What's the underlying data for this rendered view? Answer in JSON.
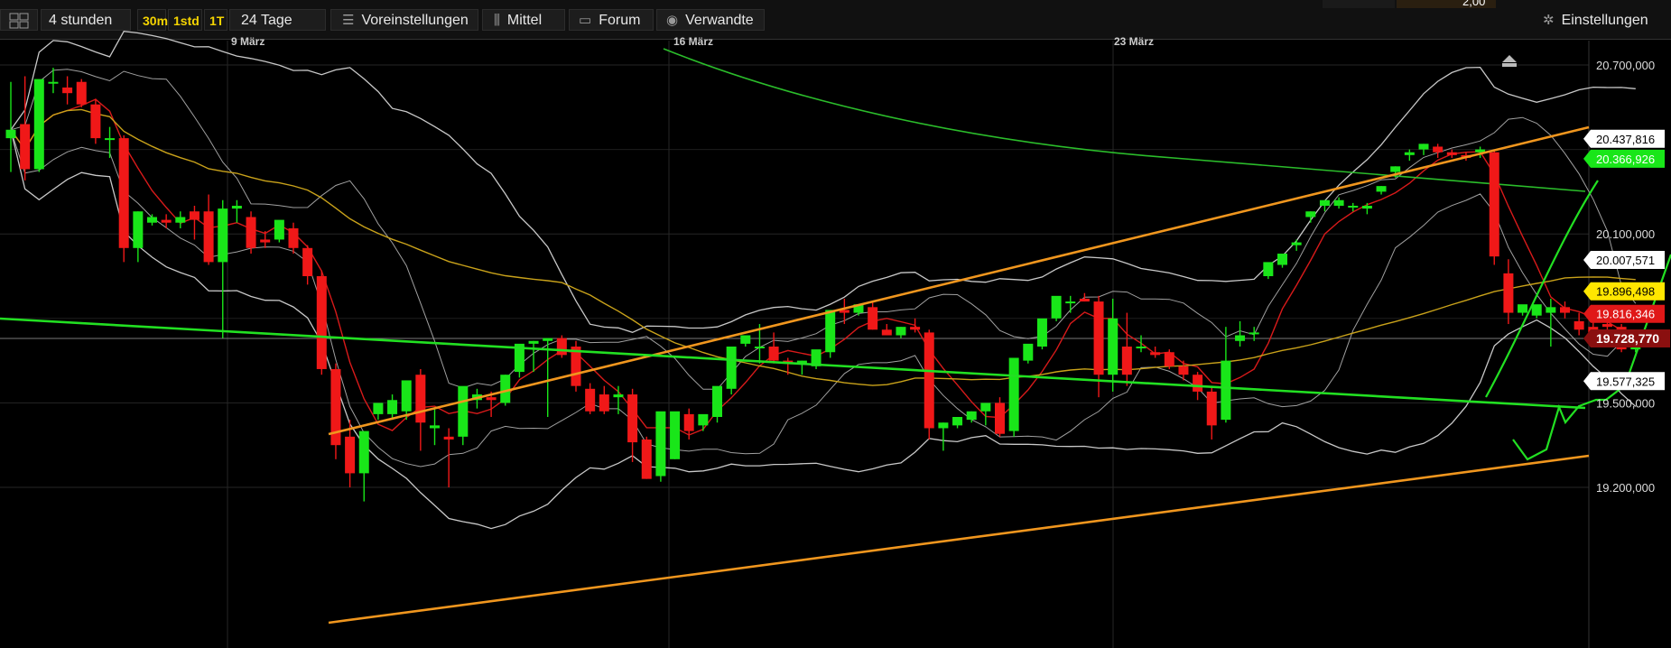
{
  "toolbar": {
    "period": "4 stunden",
    "quick_ranges": [
      "30m",
      "1std",
      "1T"
    ],
    "range": "24 Tage",
    "presets": "Voreinstellungen",
    "average": "Mittel",
    "forum": "Forum",
    "related": "Verwandte",
    "settings": "Einstellungen",
    "top_value": "2,00"
  },
  "chart_data": {
    "type": "candlestick",
    "x_tick_labels": [
      "9 März",
      "16 März",
      "23 März"
    ],
    "y_tick_labels": [
      "20.700,000",
      "20.100,000",
      "19.500,000",
      "19.200,000"
    ],
    "y_ticks": [
      20700,
      20100,
      19500,
      19200
    ],
    "ylim": [
      19050,
      20850
    ],
    "price_labels": [
      {
        "value": 20437.816,
        "text": "20.437,816",
        "style": "white"
      },
      {
        "value": 20366.926,
        "text": "20.366,926",
        "style": "green"
      },
      {
        "value": 20007.571,
        "text": "20.007,571",
        "style": "white"
      },
      {
        "value": 19896.498,
        "text": "19.896,498",
        "style": "yellow"
      },
      {
        "value": 19816.346,
        "text": "19.816,346",
        "style": "red"
      },
      {
        "value": 19728.77,
        "text": "19.728,770",
        "style": "current"
      },
      {
        "value": 19577.325,
        "text": "19.577,325",
        "style": "white"
      }
    ],
    "candles": [
      [
        20440,
        20640,
        20470,
        20320
      ],
      [
        20490,
        20660,
        20330,
        20290
      ],
      [
        20330,
        20640,
        20650,
        20320
      ],
      [
        20640,
        20690,
        20640,
        20600
      ],
      [
        20620,
        20660,
        20600,
        20560
      ],
      [
        20640,
        20650,
        20560,
        20550
      ],
      [
        20560,
        20580,
        20440,
        20420
      ],
      [
        20440,
        20480,
        20440,
        20370
      ],
      [
        20440,
        20450,
        20050,
        20000
      ],
      [
        20050,
        20180,
        20180,
        20000
      ],
      [
        20140,
        20170,
        20160,
        20130
      ],
      [
        20150,
        20170,
        20140,
        20120
      ],
      [
        20140,
        20180,
        20160,
        20120
      ],
      [
        20180,
        20200,
        20150,
        20080
      ],
      [
        20180,
        20240,
        20000,
        19990
      ],
      [
        20000,
        20220,
        20190,
        19730
      ],
      [
        20190,
        20220,
        20200,
        20140
      ],
      [
        20160,
        20180,
        20050,
        20030
      ],
      [
        20080,
        20110,
        20070,
        20050
      ],
      [
        20080,
        20110,
        20150,
        20070
      ],
      [
        20120,
        20140,
        20050,
        20030
      ],
      [
        20050,
        20060,
        19950,
        19920
      ],
      [
        19950,
        19970,
        19620,
        19600
      ],
      [
        19620,
        19640,
        19350,
        19300
      ],
      [
        19380,
        19440,
        19250,
        19200
      ],
      [
        19250,
        19270,
        19400,
        19150
      ],
      [
        19460,
        19480,
        19500,
        19440
      ],
      [
        19460,
        19530,
        19510,
        19440
      ],
      [
        19470,
        19520,
        19580,
        19440
      ],
      [
        19600,
        19620,
        19430,
        19330
      ],
      [
        19410,
        19480,
        19420,
        19350
      ],
      [
        19380,
        19410,
        19370,
        19200
      ],
      [
        19380,
        19460,
        19560,
        19350
      ],
      [
        19510,
        19550,
        19530,
        19480
      ],
      [
        19520,
        19540,
        19510,
        19450
      ],
      [
        19500,
        19600,
        19600,
        19490
      ],
      [
        19610,
        19620,
        19710,
        19590
      ],
      [
        19710,
        19720,
        19720,
        19610
      ],
      [
        19720,
        19730,
        19730,
        19450
      ],
      [
        19730,
        19740,
        19670,
        19660
      ],
      [
        19700,
        19720,
        19560,
        19540
      ],
      [
        19550,
        19570,
        19470,
        19460
      ],
      [
        19530,
        19560,
        19470,
        19460
      ],
      [
        19520,
        19560,
        19530,
        19460
      ],
      [
        19530,
        19550,
        19360,
        19290
      ],
      [
        19370,
        19380,
        19230,
        19230
      ],
      [
        19240,
        19260,
        19470,
        19220
      ],
      [
        19300,
        19320,
        19470,
        19300
      ],
      [
        19460,
        19480,
        19400,
        19370
      ],
      [
        19420,
        19450,
        19460,
        19400
      ],
      [
        19450,
        19520,
        19560,
        19430
      ],
      [
        19550,
        19570,
        19700,
        19530
      ],
      [
        19710,
        19730,
        19740,
        19700
      ],
      [
        19700,
        19780,
        19700,
        19640
      ],
      [
        19700,
        19750,
        19650,
        19640
      ],
      [
        19650,
        19660,
        19640,
        19600
      ],
      [
        19640,
        19650,
        19650,
        19600
      ],
      [
        19630,
        19640,
        19690,
        19620
      ],
      [
        19680,
        19690,
        19830,
        19660
      ],
      [
        19830,
        19870,
        19820,
        19780
      ],
      [
        19820,
        19840,
        19850,
        19810
      ],
      [
        19840,
        19860,
        19760,
        19760
      ],
      [
        19760,
        19780,
        19740,
        19740
      ],
      [
        19740,
        19770,
        19770,
        19730
      ],
      [
        19770,
        19800,
        19760,
        19750
      ],
      [
        19750,
        19760,
        19410,
        19370
      ],
      [
        19410,
        19430,
        19430,
        19330
      ],
      [
        19420,
        19440,
        19450,
        19410
      ],
      [
        19440,
        19470,
        19470,
        19430
      ],
      [
        19470,
        19490,
        19500,
        19420
      ],
      [
        19500,
        19520,
        19390,
        19380
      ],
      [
        19400,
        19430,
        19660,
        19380
      ],
      [
        19650,
        19680,
        19710,
        19640
      ],
      [
        19700,
        19750,
        19800,
        19690
      ],
      [
        19800,
        19850,
        19880,
        19790
      ],
      [
        19860,
        19880,
        19860,
        19820
      ],
      [
        19870,
        19890,
        19860,
        19860
      ],
      [
        19860,
        19880,
        19600,
        19520
      ],
      [
        19600,
        19870,
        19800,
        19540
      ],
      [
        19700,
        19820,
        19600,
        19560
      ],
      [
        19700,
        19740,
        19700,
        19680
      ],
      [
        19680,
        19700,
        19670,
        19660
      ],
      [
        19680,
        19690,
        19630,
        19620
      ],
      [
        19630,
        19650,
        19600,
        19580
      ],
      [
        19600,
        19610,
        19540,
        19510
      ],
      [
        19540,
        19560,
        19420,
        19370
      ],
      [
        19440,
        19770,
        19650,
        19430
      ],
      [
        19720,
        19790,
        19740,
        19700
      ],
      [
        19750,
        19770,
        19750,
        19720
      ],
      [
        19950,
        19970,
        20000,
        19940
      ],
      [
        19990,
        20020,
        20030,
        19980
      ],
      [
        20060,
        20080,
        20070,
        20040
      ],
      [
        20160,
        20180,
        20180,
        20140
      ],
      [
        20200,
        20220,
        20220,
        20180
      ],
      [
        20200,
        20230,
        20220,
        20190
      ],
      [
        20200,
        20210,
        20200,
        20180
      ],
      [
        20190,
        20210,
        20200,
        20170
      ],
      [
        20250,
        20270,
        20270,
        20240
      ],
      [
        20320,
        20340,
        20340,
        20300
      ],
      [
        20380,
        20400,
        20390,
        20360
      ],
      [
        20400,
        20420,
        20420,
        20380
      ],
      [
        20410,
        20420,
        20390,
        20370
      ],
      [
        20390,
        20400,
        20380,
        20370
      ],
      [
        20380,
        20390,
        20370,
        20360
      ],
      [
        20390,
        20410,
        20400,
        20370
      ],
      [
        20390,
        20400,
        20020,
        19990
      ],
      [
        19960,
        20010,
        19820,
        19780
      ],
      [
        19820,
        19840,
        19850,
        19810
      ],
      [
        19810,
        19830,
        19850,
        19800
      ],
      [
        19820,
        19870,
        19840,
        19700
      ],
      [
        19840,
        19860,
        19820,
        19800
      ],
      [
        19790,
        19820,
        19760,
        19740
      ],
      [
        19770,
        19790,
        19750,
        19740
      ],
      [
        19780,
        19800,
        19770,
        19750
      ],
      [
        19770,
        19780,
        19690,
        19680
      ],
      [
        19690,
        19700,
        19700,
        19680
      ]
    ],
    "projection_path": [
      [
        1676,
        487
      ],
      [
        1692,
        509
      ],
      [
        1713,
        498
      ],
      [
        1727,
        451
      ],
      [
        1734,
        468
      ],
      [
        1749,
        450
      ],
      [
        1768,
        443
      ],
      [
        1779,
        443
      ],
      [
        1800,
        427
      ],
      [
        1851,
        282
      ]
    ]
  }
}
